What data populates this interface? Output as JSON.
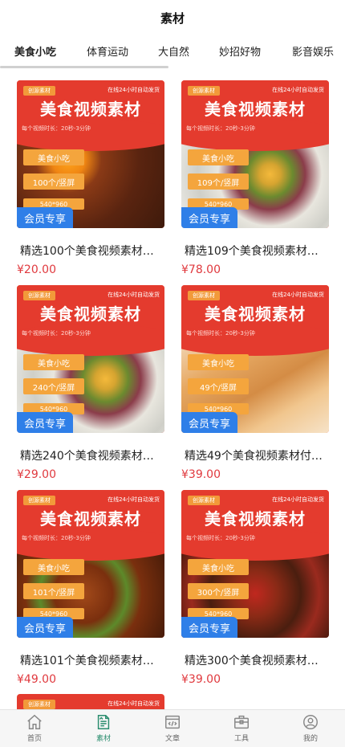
{
  "header": {
    "title": "素材"
  },
  "tabs": [
    {
      "label": "美食小吃",
      "active": true
    },
    {
      "label": "体育运动",
      "active": false
    },
    {
      "label": "大自然",
      "active": false
    },
    {
      "label": "妙招好物",
      "active": false
    },
    {
      "label": "影音娱乐",
      "active": false
    }
  ],
  "poster": {
    "tag": "创源素材",
    "online": "在线24小时自动发货",
    "headline": "美食视频素材",
    "duration": "每个视频时长：20秒-3分钟",
    "category": "美食小吃",
    "resolution": "540*960",
    "member": "会员专享"
  },
  "products": [
    {
      "title": "精选100个美食视频素材…",
      "price": "¥20.00",
      "count": "100个/竖屏",
      "style": "egg"
    },
    {
      "title": "精选109个美食视频素材…",
      "price": "¥78.00",
      "count": "109个/竖屏",
      "style": "salad"
    },
    {
      "title": "精选240个美食视频素材…",
      "price": "¥29.00",
      "count": "240个/竖屏",
      "style": "salad"
    },
    {
      "title": "精选49个美食视频素材付…",
      "price": "¥39.00",
      "count": "49个/竖屏",
      "style": "crepe"
    },
    {
      "title": "精选101个美食视频素材…",
      "price": "¥49.00",
      "count": "101个/竖屏",
      "style": "chicken"
    },
    {
      "title": "精选300个美食视频素材…",
      "price": "¥39.00",
      "count": "300个/竖屏",
      "style": "pepper"
    }
  ],
  "partial_card": {
    "tag": "创源素材",
    "online": "在线24小时自动发货"
  },
  "bottom_nav": [
    {
      "label": "首页",
      "icon": "home-icon",
      "active": false
    },
    {
      "label": "素材",
      "icon": "material-icon",
      "active": true
    },
    {
      "label": "文章",
      "icon": "article-icon",
      "active": false
    },
    {
      "label": "工具",
      "icon": "toolbox-icon",
      "active": false
    },
    {
      "label": "我的",
      "icon": "profile-icon",
      "active": false
    }
  ],
  "colors": {
    "accent": "#2a8d6e",
    "price": "#e0393e",
    "member": "#2f7fe8",
    "poster_red": "#e43b2e",
    "poster_orange": "#f4a53d"
  }
}
